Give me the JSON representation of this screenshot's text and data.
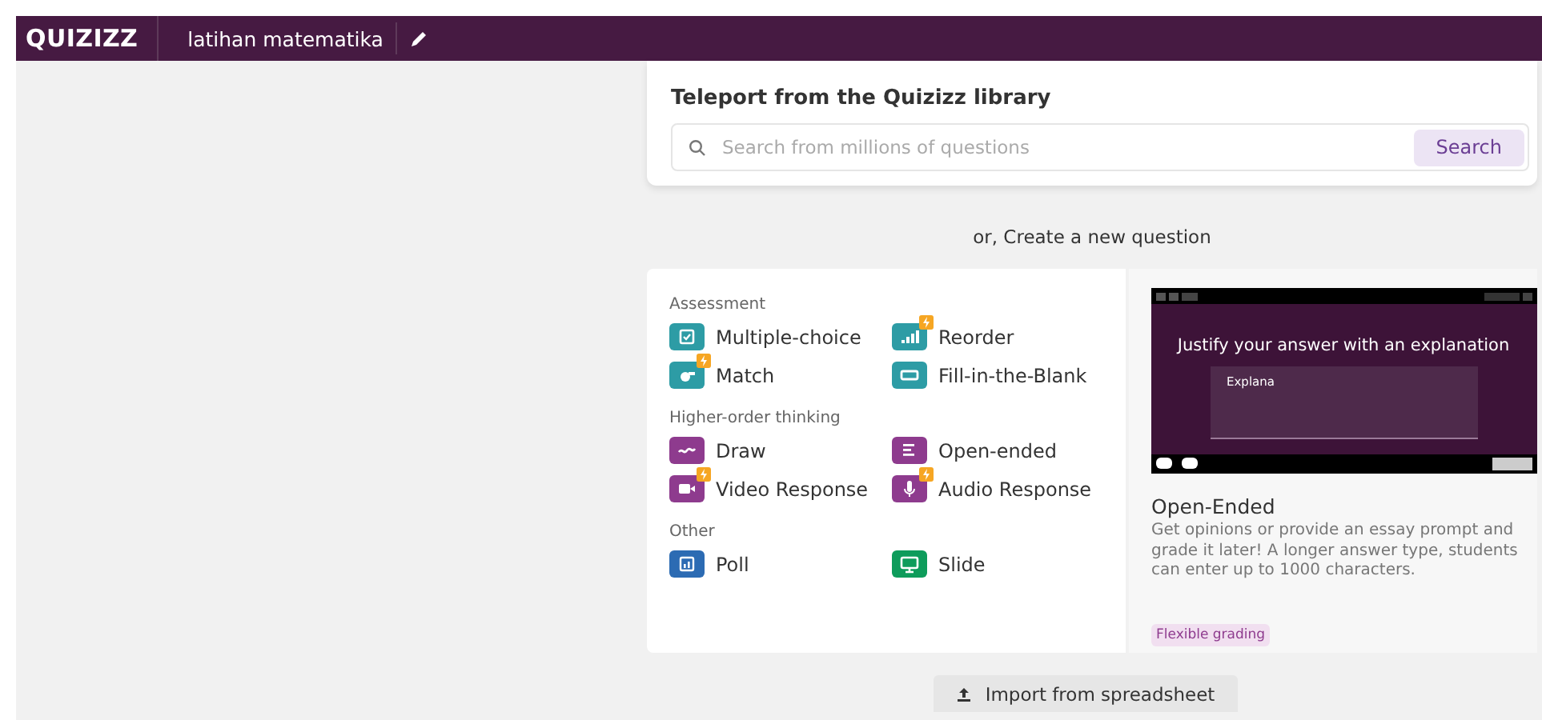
{
  "header": {
    "logo": "QUIZIZZ",
    "title": "latihan matematika"
  },
  "library": {
    "title": "Teleport from the Quizizz library",
    "placeholder": "Search from millions of questions",
    "button": "Search"
  },
  "divider_text": "or, Create a new question",
  "groups": [
    {
      "title": "Assessment",
      "items": [
        {
          "label": "Multiple-choice",
          "color": "#2d9ca5",
          "premium": false
        },
        {
          "label": "Reorder",
          "color": "#2d9ca5",
          "premium": true
        },
        {
          "label": "Match",
          "color": "#2d9ca5",
          "premium": true
        },
        {
          "label": "Fill-in-the-Blank",
          "color": "#2d9ca5",
          "premium": false
        }
      ]
    },
    {
      "title": "Higher-order thinking",
      "items": [
        {
          "label": "Draw",
          "color": "#8e3b8e",
          "premium": false
        },
        {
          "label": "Open-ended",
          "color": "#8e3b8e",
          "premium": false
        },
        {
          "label": "Video Response",
          "color": "#8e3b8e",
          "premium": true
        },
        {
          "label": "Audio Response",
          "color": "#8e3b8e",
          "premium": true
        }
      ]
    },
    {
      "title": "Other",
      "items": [
        {
          "label": "Poll",
          "color": "#2c6bb3",
          "premium": false
        },
        {
          "label": "Slide",
          "color": "#0e9c5b",
          "premium": false
        }
      ]
    }
  ],
  "preview": {
    "screen_title": "Justify your answer with an explanation",
    "screen_input": "Explana",
    "title": "Open-Ended",
    "description": "Get opinions or provide an essay prompt and grade it later! A longer answer type, students can enter up to 1000 characters.",
    "tag": "Flexible grading"
  },
  "import_button": "Import from spreadsheet"
}
